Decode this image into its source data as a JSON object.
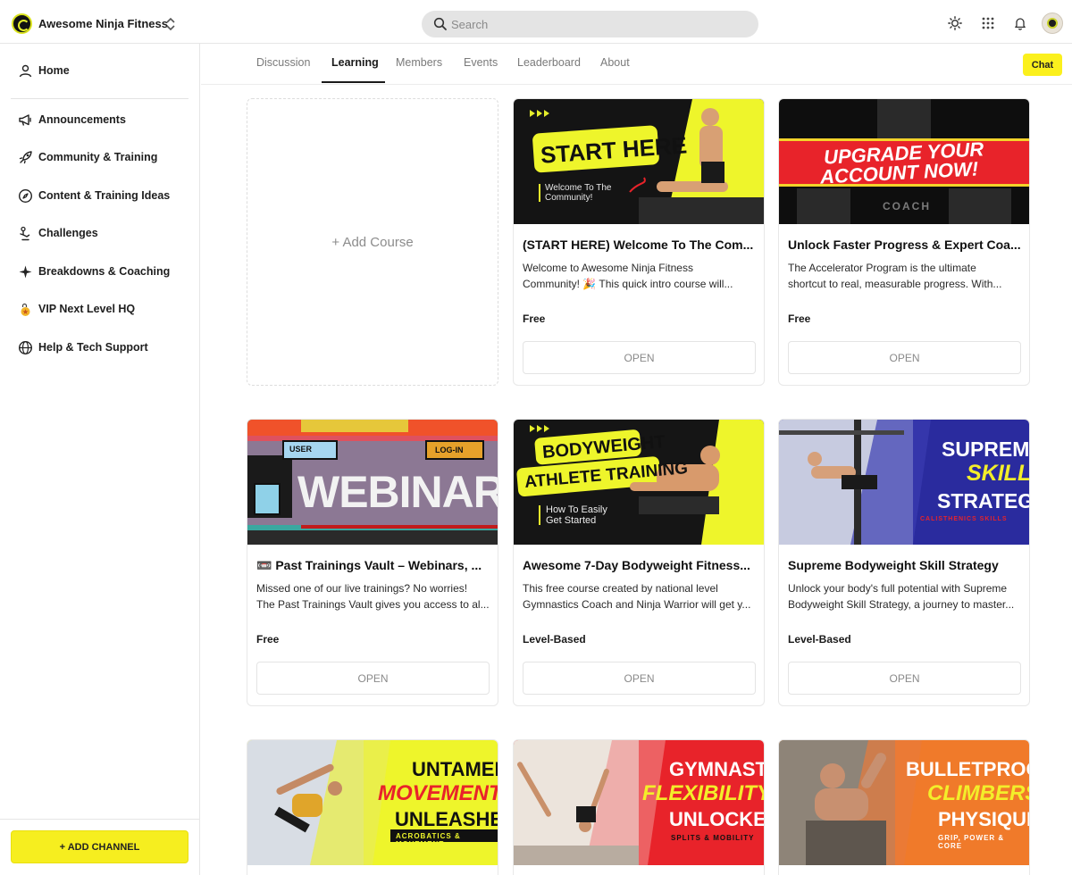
{
  "header": {
    "brand_name": "Awesome Ninja Fitness",
    "search_placeholder": "Search",
    "icons": [
      "sun-icon",
      "apps-grid-icon",
      "bell-icon"
    ]
  },
  "sidebar": {
    "items": [
      {
        "label": "Home",
        "icon": "home-icon"
      },
      {
        "label": "Announcements",
        "icon": "megaphone-icon"
      },
      {
        "label": "Community & Training",
        "icon": "rocket-icon"
      },
      {
        "label": "Content & Training Ideas",
        "icon": "compass-icon"
      },
      {
        "label": "Challenges",
        "icon": "trophy-icon"
      },
      {
        "label": "Breakdowns & Coaching",
        "icon": "sparkle-icon"
      },
      {
        "label": "VIP Next Level HQ",
        "icon": "lock-medal-icon"
      },
      {
        "label": "Help & Tech Support",
        "icon": "globe-icon"
      }
    ],
    "add_channel_label": "+ ADD CHANNEL"
  },
  "tabs": {
    "items": [
      "Discussion",
      "Learning",
      "Members",
      "Events",
      "Leaderboard",
      "About"
    ],
    "active": "Learning",
    "chat_label": "Chat"
  },
  "courses": {
    "add_course_label": "+ Add Course",
    "open_label": "OPEN",
    "cards": [
      {
        "title": "(START HERE) Welcome To The Com...",
        "desc1": "Welcome to Awesome Ninja Fitness",
        "desc2": "Community! 🎉 This quick intro course will...",
        "price": "Free",
        "banner": {
          "line1": "START HERE",
          "line2": "Welcome To The",
          "line3": "Community!"
        }
      },
      {
        "title": "Unlock Faster Progress & Expert Coa...",
        "desc1": "The Accelerator Program is the ultimate",
        "desc2": "shortcut to real, measurable progress. With...",
        "price": "Free",
        "banner": {
          "line1": "UPGRADE YOUR",
          "line2": "ACCOUNT NOW!",
          "line3": "COACH"
        }
      },
      {
        "title": "📼 Past Trainings Vault – Webinars, ...",
        "desc1": "Missed one of our live trainings? No worries!",
        "desc2": "The Past Trainings Vault gives you access to al...",
        "price": "Free",
        "banner": {
          "line1": "WEBINAR",
          "line2": "USER",
          "line3": "LOG-IN"
        }
      },
      {
        "title": "Awesome 7-Day Bodyweight Fitness...",
        "desc1": "This free course created by national level",
        "desc2": "Gymnastics Coach and Ninja Warrior will get y...",
        "price": "Level-Based",
        "banner": {
          "line1": "BODYWEIGHT",
          "line2": "ATHLETE TRAINING",
          "line3": "How To Easily",
          "line4": "Get Started"
        }
      },
      {
        "title": "Supreme Bodyweight Skill Strategy",
        "desc1": "Unlock your body's full potential with Supreme",
        "desc2": "Bodyweight Skill Strategy, a journey to master...",
        "price": "Level-Based",
        "banner": {
          "line1": "SUPREME",
          "line2": "SKILL",
          "line3": "STRATEGY",
          "line4": "CALISTHENICS SKILLS"
        }
      },
      {
        "banner": {
          "line1": "UNTAMED",
          "line2": "MOVEMENT",
          "line3": "UNLEASHED",
          "line4": "ACROBATICS & MOVEMENT"
        }
      },
      {
        "banner": {
          "line1": "GYMNASTS",
          "line2": "FLEXIBILITY",
          "line3": "UNLOCKED",
          "line4": "SPLITS & MOBILITY"
        }
      },
      {
        "banner": {
          "line1": "BULLETPROOF",
          "line2": "CLIMBERS",
          "line3": "PHYSIQUE",
          "line4": "GRIP, POWER & CORE"
        }
      }
    ]
  },
  "colors": {
    "accent_yellow": "#f6ee1f",
    "banner_red": "#e8232a",
    "banner_blue": "#2a2b9e",
    "banner_orange": "#f07a2a"
  }
}
